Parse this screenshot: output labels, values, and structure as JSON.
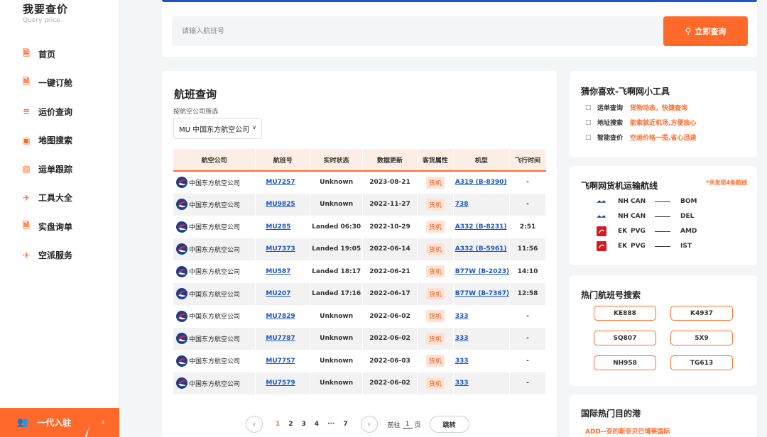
{
  "brand": {
    "title": "我要查价",
    "subtitle": "Query price"
  },
  "nav": [
    {
      "label": "首页",
      "icon": "document-icon"
    },
    {
      "label": "一键订舱",
      "icon": "document-icon"
    },
    {
      "label": "运价查询",
      "icon": "list-icon"
    },
    {
      "label": "地图搜索",
      "icon": "box-icon"
    },
    {
      "label": "运单跟踪",
      "icon": "tracking-icon"
    },
    {
      "label": "工具大全",
      "icon": "plane-icon"
    },
    {
      "label": "实盘询单",
      "icon": "document-icon"
    },
    {
      "label": "空派服务",
      "icon": "plane-icon"
    }
  ],
  "join": {
    "label": "一代入驻",
    "arrow": "›"
  },
  "search": {
    "placeholder": "请输入航班号",
    "button": "立即查询"
  },
  "main": {
    "title": "航班查询",
    "filter_label": "按航空公司筛选",
    "filter_value": "MU 中国东方航空公司",
    "columns": [
      "航空公司",
      "航班号",
      "实时状态",
      "数据更新",
      "客货属性",
      "机型",
      "飞行时间"
    ],
    "rows": [
      {
        "airline": "中国东方航空公司",
        "flight": "MU7257",
        "status": "Unknown",
        "updated": "2023-08-21",
        "type": "货机",
        "aircraft": "A319 (B-8390)",
        "duration": "-"
      },
      {
        "airline": "中国东方航空公司",
        "flight": "MU9825",
        "status": "Unknown",
        "updated": "2022-11-27",
        "type": "货机",
        "aircraft": "738",
        "duration": "-"
      },
      {
        "airline": "中国东方航空公司",
        "flight": "MU285",
        "status": "Landed 06:30",
        "updated": "2022-10-29",
        "type": "货机",
        "aircraft": "A332 (B-8231)",
        "duration": "2:51"
      },
      {
        "airline": "中国东方航空公司",
        "flight": "MU7373",
        "status": "Landed 19:05",
        "updated": "2022-06-14",
        "type": "货机",
        "aircraft": "A332 (B-5961)",
        "duration": "11:56"
      },
      {
        "airline": "中国东方航空公司",
        "flight": "MU587",
        "status": "Landed 18:17",
        "updated": "2022-06-21",
        "type": "货机",
        "aircraft": "B77W (B-2023)",
        "duration": "14:10"
      },
      {
        "airline": "中国东方航空公司",
        "flight": "MU207",
        "status": "Landed 17:16",
        "updated": "2022-06-17",
        "type": "货机",
        "aircraft": "B77W (B-7367)",
        "duration": "12:58"
      },
      {
        "airline": "中国东方航空公司",
        "flight": "MU7829",
        "status": "Unknown",
        "updated": "2022-06-02",
        "type": "货机",
        "aircraft": "333",
        "duration": "-"
      },
      {
        "airline": "中国东方航空公司",
        "flight": "MU7787",
        "status": "Unknown",
        "updated": "2022-06-02",
        "type": "货机",
        "aircraft": "333",
        "duration": "-"
      },
      {
        "airline": "中国东方航空公司",
        "flight": "MU7757",
        "status": "Unknown",
        "updated": "2022-06-03",
        "type": "货机",
        "aircraft": "333",
        "duration": "-"
      },
      {
        "airline": "中国东方航空公司",
        "flight": "MU7579",
        "status": "Unknown",
        "updated": "2022-06-02",
        "type": "货机",
        "aircraft": "333",
        "duration": "-"
      }
    ],
    "pager": {
      "prev": "‹",
      "next": "›",
      "pages": [
        "1",
        "2",
        "3",
        "4",
        "···",
        "7"
      ],
      "active": "1",
      "goto_prefix": "前往",
      "goto_value": "1",
      "goto_suffix": "页",
      "jump": "跳转"
    }
  },
  "tools": {
    "title": "猜你喜欢-飞啊网小工具",
    "items": [
      {
        "name": "运单查询",
        "desc": "货物动态，快捷查询",
        "icon": "clipboard-icon"
      },
      {
        "name": "地址搜索",
        "desc": "能索就近机场,方便放心",
        "icon": "location-icon"
      },
      {
        "name": "智能查价",
        "desc": "空运价格一揽,省心迅速",
        "icon": "search-icon"
      }
    ]
  },
  "routes": {
    "title": "飞啊网货机运输航线",
    "note": "*共发现4条航线",
    "items": [
      {
        "code": "NH",
        "from": "CAN",
        "to": "BOM",
        "logo": "ana-logo-icon"
      },
      {
        "code": "NH",
        "from": "CAN",
        "to": "DEL",
        "logo": "ana-logo-icon"
      },
      {
        "code": "EK",
        "from": "PVG",
        "to": "AMD",
        "logo": "emirates-logo-icon"
      },
      {
        "code": "EK",
        "from": "PVG",
        "to": "IST",
        "logo": "emirates-logo-icon"
      }
    ]
  },
  "hot_flights": {
    "title": "热门航班号搜索",
    "items": [
      "KE888",
      "K4937",
      "SQ807",
      "5X9",
      "NH958",
      "TG613"
    ]
  },
  "ports": {
    "title": "国际热门目的港",
    "sub": "ADD--亚的斯亚贝巴博莱国际"
  },
  "colors": {
    "accent": "#ff6a2a",
    "link": "#1b55c6",
    "header_bg": "#fdeee5"
  }
}
